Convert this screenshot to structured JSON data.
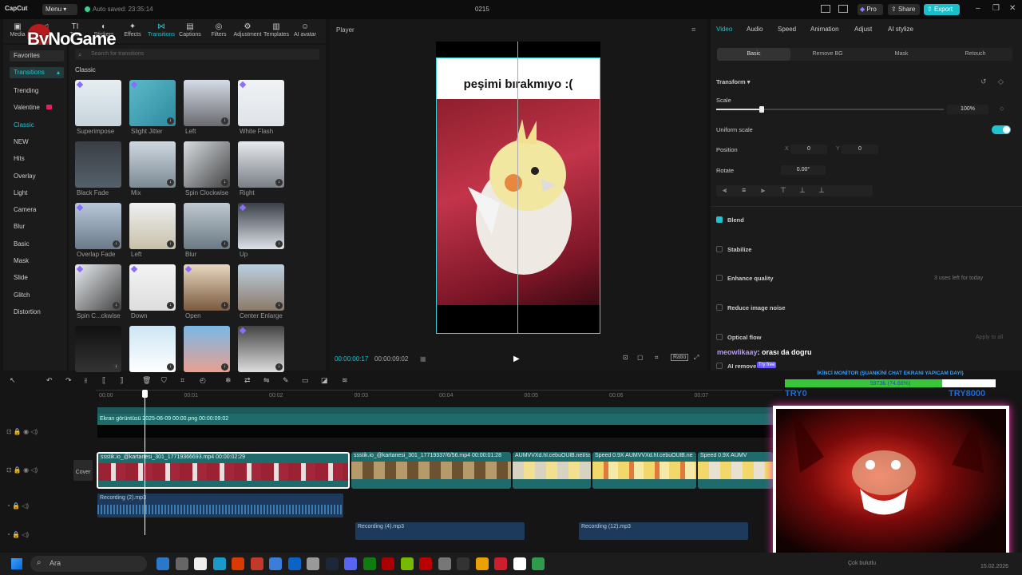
{
  "titlebar": {
    "app_name": "CapCut",
    "menu_label": "Menu",
    "autosave": "Auto saved: 23:35:14",
    "project_title": "0215",
    "pro_label": "Pro",
    "share_label": "Share",
    "export_label": "Export"
  },
  "toolbar": {
    "items": [
      {
        "label": "Media",
        "icon": "media-icon"
      },
      {
        "label": "Audio",
        "icon": "audio-icon"
      },
      {
        "label": "Text",
        "icon": "text-icon"
      },
      {
        "label": "Stickers",
        "icon": "stickers-icon"
      },
      {
        "label": "Effects",
        "icon": "effects-icon"
      },
      {
        "label": "Transitions",
        "icon": "transitions-icon"
      },
      {
        "label": "Captions",
        "icon": "captions-icon"
      },
      {
        "label": "Filters",
        "icon": "filters-icon"
      },
      {
        "label": "Adjustment",
        "icon": "adjustment-icon"
      },
      {
        "label": "Templates",
        "icon": "templates-icon"
      },
      {
        "label": "AI avatar",
        "icon": "ai-avatar-icon"
      }
    ],
    "active": "Transitions"
  },
  "watermark": "ByNoGame",
  "categories": {
    "favorites": "Favorites",
    "transitions": "Transitions",
    "items": [
      "Trending",
      "Valentine",
      "Classic",
      "NEW",
      "Hits",
      "Overlay",
      "Light",
      "Camera",
      "Blur",
      "Basic",
      "Mask",
      "Slide",
      "Glitch",
      "Distortion"
    ],
    "selected": "Classic"
  },
  "transitions_panel": {
    "search_placeholder": "Search for transitions",
    "section": "Classic",
    "tiles": [
      {
        "label": "Superimpose"
      },
      {
        "label": "Slight Jitter"
      },
      {
        "label": "Left"
      },
      {
        "label": "White Flash"
      },
      {
        "label": "Black Fade"
      },
      {
        "label": "Mix"
      },
      {
        "label": "Spin Clockwise"
      },
      {
        "label": "Right"
      },
      {
        "label": "Overlap Fade"
      },
      {
        "label": "Left"
      },
      {
        "label": "Blur"
      },
      {
        "label": "Up"
      },
      {
        "label": "Spin C...ckwise"
      },
      {
        "label": "Down"
      },
      {
        "label": "Open"
      },
      {
        "label": "Center Enlarge"
      },
      {
        "label": ""
      },
      {
        "label": ""
      },
      {
        "label": ""
      },
      {
        "label": ""
      }
    ]
  },
  "player": {
    "title": "Player",
    "caption": "peşimi bırakmıyo :(",
    "current_time": "00:00:00:17",
    "total_time": "00:00:09:02",
    "ratio_label": "Ratio"
  },
  "right_panel": {
    "tabs": [
      "Video",
      "Audio",
      "Speed",
      "Animation",
      "Adjust",
      "AI stylize"
    ],
    "active_tab": "Video",
    "subtabs": [
      "Basic",
      "Remove BG",
      "Mask",
      "Retouch"
    ],
    "active_subtab": "Basic",
    "transform_label": "Transform",
    "scale_label": "Scale",
    "scale_value": "100%",
    "scale_fraction": 0.2,
    "uniform_scale_label": "Uniform scale",
    "position_label": "Position",
    "pos_x_label": "X",
    "pos_x": "0",
    "pos_y_label": "Y",
    "pos_y": "0",
    "rotate_label": "Rotate",
    "rotate_value": "0.00°",
    "blend_label": "Blend",
    "stabilize_label": "Stabilize",
    "enhance_label": "Enhance quality",
    "enhance_note": "3 uses left for today",
    "reduce_noise_label": "Reduce image noise",
    "optical_flow_label": "Optical flow",
    "apply_all": "Apply to all",
    "ai_remove_label": "AI remove",
    "try_free": "Try free"
  },
  "chat": {
    "user": "meowlikaay",
    "message": ": orası da dogru"
  },
  "overlay": {
    "goal_title": "İKİNCİ MONİTOR (ŞUANKİNİ CHAT EKRANI YAPICAM DAYI)",
    "goal_progress": "5973₺ (74.66%)",
    "goal_fraction": 0.7466,
    "goal_left": "TRY0",
    "goal_right": "TRY8000"
  },
  "timeline": {
    "ruler": [
      "00:00",
      "00:01",
      "00:02",
      "00:03",
      "00:04",
      "00:05",
      "00:06",
      "00:07"
    ],
    "overlay_clip": "Ekran görüntüsü 2025-06-09 00:00.png  00:00:09:02",
    "cover_label": "Cover",
    "clip1": "ssstik.io_@kartanesi_301_17719366693.mp4  00:00:02:29",
    "clip2": "ssstik.io_@kartanesi_301_17719337/6/56.mp4  00:00:01:28",
    "clip3": "AUMVVXd.hl.cebuOUlB.net/ss",
    "clip4": "Speed 0.9X  AUMVVXd.hl.cebuOUlB.ne",
    "clip5": "Speed 0.9X  AUMV",
    "audio1": "Recording (2).mp3",
    "audio2": "Recording (4).mp3",
    "audio3": "Recording (12).mp3"
  },
  "taskbar": {
    "search": "Ara",
    "weather": "Çok bulutlu",
    "date": "15.02.2026"
  }
}
